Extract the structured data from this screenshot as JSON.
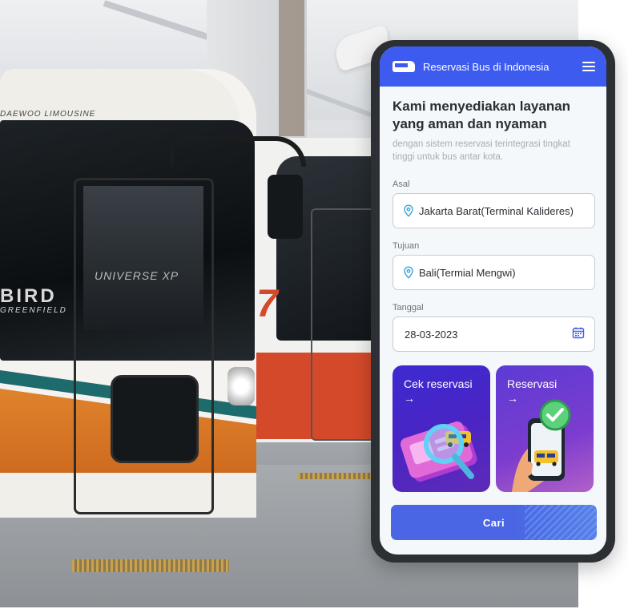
{
  "header": {
    "title": "Reservasi Bus di Indonesia",
    "menu_icon": "hamburger-menu-icon",
    "logo_icon": "bus-icon"
  },
  "hero": {
    "heading": "Kami menyediakan layanan yang aman dan nyaman",
    "subtext": "dengan sistem reservasi terintegrasi tingkat tinggi untuk bus antar kota."
  },
  "form": {
    "asal": {
      "label": "Asal",
      "value": "Jakarta Barat(Terminal Kalideres)",
      "icon": "location-pin-icon"
    },
    "tujuan": {
      "label": "Tujuan",
      "value": "Bali(Termial Mengwi)",
      "icon": "location-pin-icon"
    },
    "tanggal": {
      "label": "Tanggal",
      "value": "28-03-2023",
      "icon": "calendar-icon"
    }
  },
  "cards": [
    {
      "title": "Cek reservasi",
      "arrow": "→",
      "illustration": "ticket-magnifier-illustration"
    },
    {
      "title": "Reservasi",
      "arrow": "→",
      "illustration": "phone-checkmark-illustration"
    }
  ],
  "search_button": {
    "label": "Cari"
  },
  "background": {
    "bus_text_1": "DAEWOO LIMOUSINE",
    "bus_text_2": "BIRD",
    "bus_text_3": "GREENFIELD",
    "bus_text_4": "UNIVERSE XP"
  },
  "colors": {
    "primary": "#3d5cef",
    "card1": "#3c2bd1",
    "card2": "#7c3ccf",
    "button": "#4a66e4"
  }
}
